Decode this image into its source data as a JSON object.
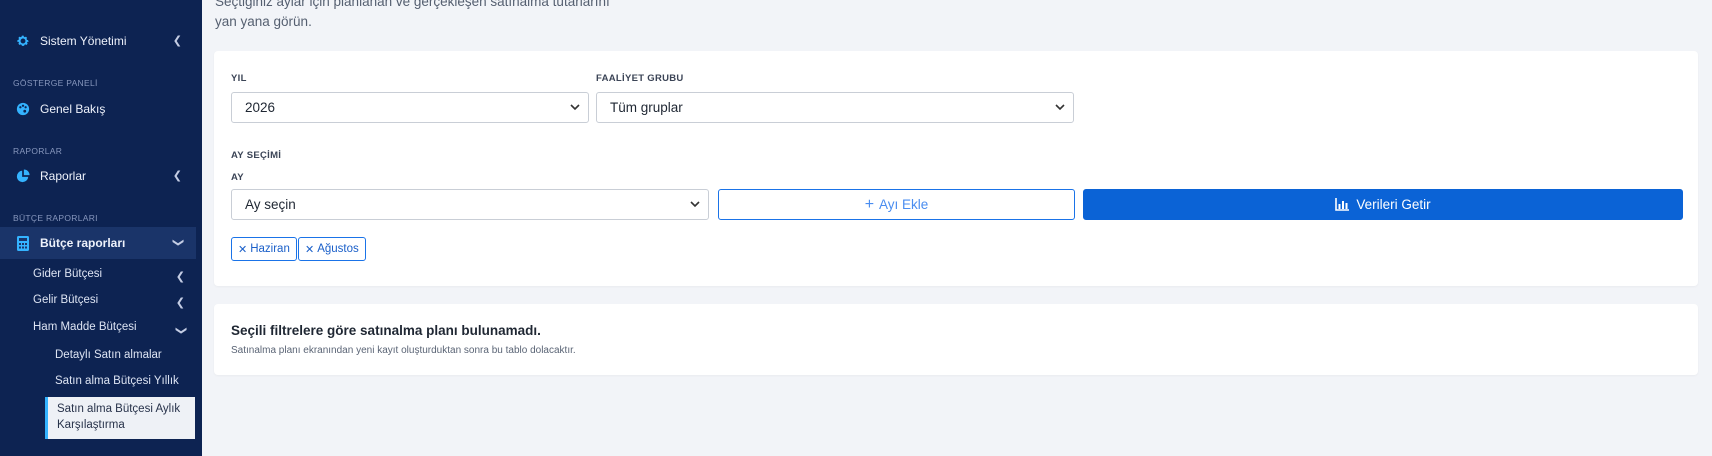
{
  "sidebar": {
    "system_management": "Sistem Yönetimi",
    "section_dashboard": "GÖSTERGE PANELİ",
    "overview": "Genel Bakış",
    "section_reports": "RAPORLAR",
    "reports": "Raporlar",
    "section_budget_reports": "BÜTÇE RAPORLARI",
    "budget_reports": "Bütçe raporları",
    "expense_budget": "Gider Bütçesi",
    "income_budget": "Gelir Bütçesi",
    "raw_material_budget": "Ham Madde Bütçesi",
    "detailed_purchases": "Detaylı Satın almalar",
    "purchase_budget_yearly": "Satın alma Bütçesi Yıllık",
    "purchase_budget_monthly_line1": "Satın alma Bütçesi Aylık",
    "purchase_budget_monthly_line2": "Karşılaştırma"
  },
  "intro": {
    "line1": "Seçtiğiniz aylar için planlanan ve gerçekleşen satınalma tutarlarını",
    "line2": "yan yana görün."
  },
  "filters": {
    "year_label": "YIL",
    "year_value": "2026",
    "group_label": "FAALİYET GRUBU",
    "group_value": "Tüm gruplar",
    "month_section_label": "AY SEÇİMİ",
    "month_label": "AY",
    "month_placeholder": "Ay seçin",
    "add_month_button": "Ayı Ekle",
    "fetch_button": "Verileri Getir",
    "selected_months": [
      "Haziran",
      "Ağustos"
    ]
  },
  "empty_state": {
    "title": "Seçili filtrelere göre satınalma planı bulunamadı.",
    "subtitle": "Satınalma planı ekranından yeni kayıt oluşturduktan sonra bu tablo dolacaktır."
  },
  "colors": {
    "sidebar_bg": "#0d2352",
    "accent": "#34b3ff",
    "primary": "#0b63d6",
    "page_bg": "#f2f4f8"
  }
}
